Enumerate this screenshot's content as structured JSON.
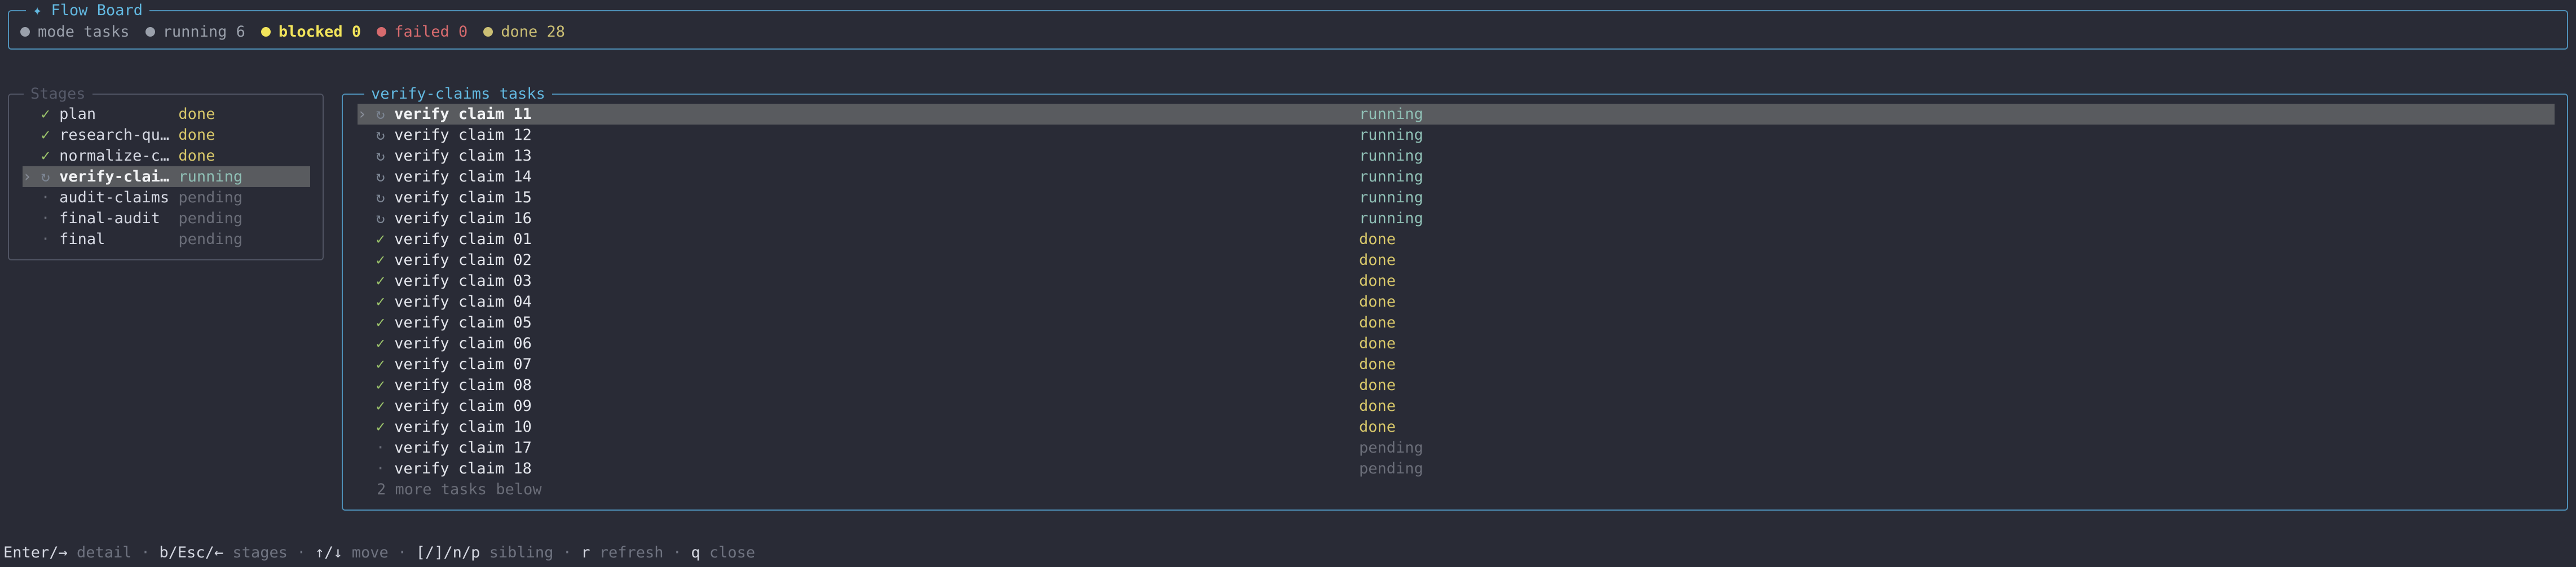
{
  "header": {
    "title": "✦ Flow Board",
    "items": [
      {
        "text": "mode tasks",
        "color": "#9aa0ab",
        "bold": false
      },
      {
        "text": "running 6",
        "color": "#9aa0ab",
        "bold": false
      },
      {
        "text": "blocked 0",
        "color": "#f2e45b",
        "bold": true
      },
      {
        "text": "failed 0",
        "color": "#d76b6e",
        "bold": false
      },
      {
        "text": "done 28",
        "color": "#cbbf74",
        "bold": false
      }
    ]
  },
  "stages": {
    "title": "Stages",
    "items": [
      {
        "icon": "✓",
        "name": "plan",
        "status": "done",
        "selected": false
      },
      {
        "icon": "✓",
        "name": "research-qu…",
        "status": "done",
        "selected": false
      },
      {
        "icon": "✓",
        "name": "normalize-c…",
        "status": "done",
        "selected": false
      },
      {
        "icon": "↻",
        "name": "verify-clai…",
        "status": "running",
        "selected": true
      },
      {
        "icon": "·",
        "name": "audit-claims",
        "status": "pending",
        "selected": false
      },
      {
        "icon": "·",
        "name": "final-audit",
        "status": "pending",
        "selected": false
      },
      {
        "icon": "·",
        "name": "final",
        "status": "pending",
        "selected": false
      }
    ]
  },
  "tasks": {
    "title": "verify-claims tasks",
    "items": [
      {
        "icon": "↻",
        "name": "verify claim 11",
        "status": "running",
        "selected": true
      },
      {
        "icon": "↻",
        "name": "verify claim 12",
        "status": "running",
        "selected": false
      },
      {
        "icon": "↻",
        "name": "verify claim 13",
        "status": "running",
        "selected": false
      },
      {
        "icon": "↻",
        "name": "verify claim 14",
        "status": "running",
        "selected": false
      },
      {
        "icon": "↻",
        "name": "verify claim 15",
        "status": "running",
        "selected": false
      },
      {
        "icon": "↻",
        "name": "verify claim 16",
        "status": "running",
        "selected": false
      },
      {
        "icon": "✓",
        "name": "verify claim 01",
        "status": "done",
        "selected": false
      },
      {
        "icon": "✓",
        "name": "verify claim 02",
        "status": "done",
        "selected": false
      },
      {
        "icon": "✓",
        "name": "verify claim 03",
        "status": "done",
        "selected": false
      },
      {
        "icon": "✓",
        "name": "verify claim 04",
        "status": "done",
        "selected": false
      },
      {
        "icon": "✓",
        "name": "verify claim 05",
        "status": "done",
        "selected": false
      },
      {
        "icon": "✓",
        "name": "verify claim 06",
        "status": "done",
        "selected": false
      },
      {
        "icon": "✓",
        "name": "verify claim 07",
        "status": "done",
        "selected": false
      },
      {
        "icon": "✓",
        "name": "verify claim 08",
        "status": "done",
        "selected": false
      },
      {
        "icon": "✓",
        "name": "verify claim 09",
        "status": "done",
        "selected": false
      },
      {
        "icon": "✓",
        "name": "verify claim 10",
        "status": "done",
        "selected": false
      },
      {
        "icon": "·",
        "name": "verify claim 17",
        "status": "pending",
        "selected": false
      },
      {
        "icon": "·",
        "name": "verify claim 18",
        "status": "pending",
        "selected": false
      }
    ],
    "more": "2 more tasks below"
  },
  "footer": {
    "selected_marker": "›",
    "separator": "·",
    "hints": [
      {
        "key": "Enter/→",
        "desc": "detail"
      },
      {
        "key": "b/Esc/←",
        "desc": "stages"
      },
      {
        "key": "↑/↓",
        "desc": "move"
      },
      {
        "key": "[/]/n/p",
        "desc": "sibling"
      },
      {
        "key": "r",
        "desc": "refresh"
      },
      {
        "key": "q",
        "desc": "close"
      }
    ]
  }
}
